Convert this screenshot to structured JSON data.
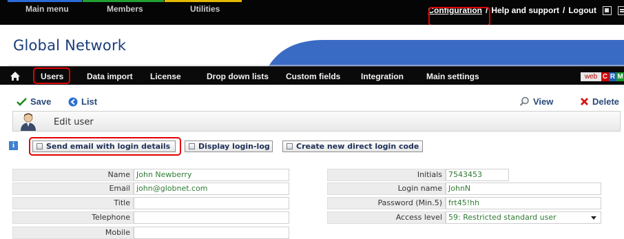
{
  "top_menu": {
    "main_menu": "Main menu",
    "members": "Members",
    "utilities": "Utilities",
    "configuration": "Configuration",
    "separator": "/",
    "help": "Help and support",
    "logout": "Logout",
    "stripe_colors": [
      "#2b6bd6",
      "#21a030",
      "#e5b800"
    ]
  },
  "brand": {
    "name": "Global Network",
    "accent": "#3a6bc4"
  },
  "module_nav": {
    "items": [
      "Users",
      "Data import",
      "License",
      "Drop down lists",
      "Custom fields",
      "Integration",
      "Main settings"
    ],
    "badge": {
      "web": "web",
      "c": "C",
      "r": "R",
      "m": "M"
    }
  },
  "toolbar": {
    "save": "Save",
    "list": "List",
    "view": "View",
    "delete": "Delete"
  },
  "edit_panel": {
    "title": "Edit user"
  },
  "actions": {
    "send_email": "Send email with login details",
    "display_log": "Display login-log",
    "create_code": "Create new direct login code"
  },
  "form": {
    "left": [
      {
        "label": "Name",
        "value": "John Newberry"
      },
      {
        "label": "Email",
        "value": "john@globnet.com"
      },
      {
        "label": "Title",
        "value": ""
      },
      {
        "label": "Telephone",
        "value": ""
      },
      {
        "label": "Mobile",
        "value": ""
      }
    ],
    "right": [
      {
        "label": "Initials",
        "value": "7543453"
      },
      {
        "label": "Login name",
        "value": "JohnN"
      },
      {
        "label": "Password (Min.5)",
        "value": "frt45!hh"
      },
      {
        "label": "Access level",
        "value": "59: Restricted standard user"
      }
    ]
  },
  "colors": {
    "highlight": "#e00000",
    "link": "#27497a",
    "value_text": "#2f7a33"
  }
}
